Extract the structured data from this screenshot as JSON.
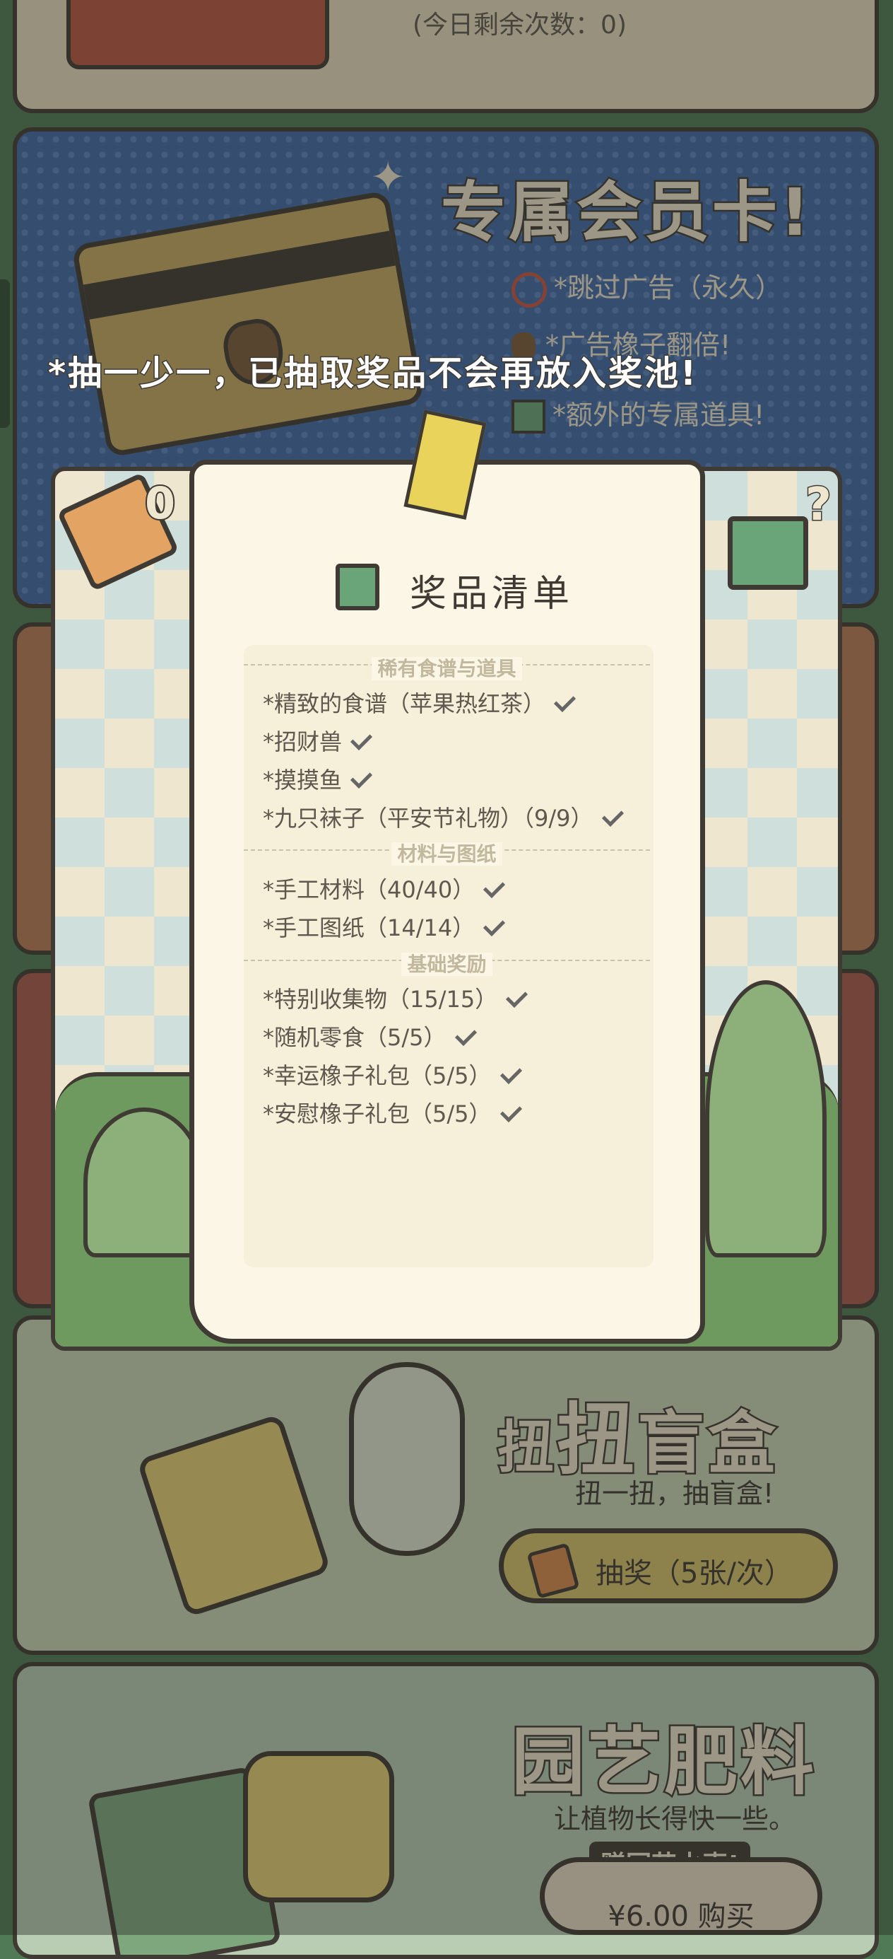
{
  "top_card": {
    "remaining_text": "(今日剩余次数：0)"
  },
  "member_card": {
    "title": "专属会员卡!",
    "perks": [
      "*跳过广告（永久）",
      "*广告橡子翻倍!",
      "*额外的专属道具!"
    ]
  },
  "notice": "*抽一少一，已抽取奖品不会再放入奖池!",
  "ticket_count": "0",
  "prize_list": {
    "title": "奖品清单",
    "sections": [
      {
        "name": "稀有食谱与道具",
        "items": [
          "*精致的食谱（苹果热红茶）",
          "*招财兽",
          "*摸摸鱼",
          "*九只袜子（平安节礼物）（9/9）"
        ]
      },
      {
        "name": "材料与图纸",
        "items": [
          "*手工材料（40/40）",
          "*手工图纸（14/14）"
        ]
      },
      {
        "name": "基础奖励",
        "items": [
          "*特别收集物（15/15）",
          "*随机零食（5/5）",
          "*幸运橡子礼包（5/5）",
          "*安慰橡子礼包（5/5）"
        ]
      }
    ]
  },
  "blind_box": {
    "title_left": "扭",
    "title_mid": "扭",
    "title_right": "盲盒",
    "subtitle": "扭一扭，抽盲盒!",
    "button_label": "抽奖（5张/次）"
  },
  "fertilizer": {
    "title": "园艺肥料",
    "subtitle": "让植物长得快一些。",
    "badge": "赠园艺水壶!",
    "price_button": "¥6.00 购买"
  },
  "colors": {
    "bg_green": "#4f7a55",
    "paper": "#fbf6e6",
    "outline": "#3f3a33",
    "button": "#d8c36a"
  }
}
